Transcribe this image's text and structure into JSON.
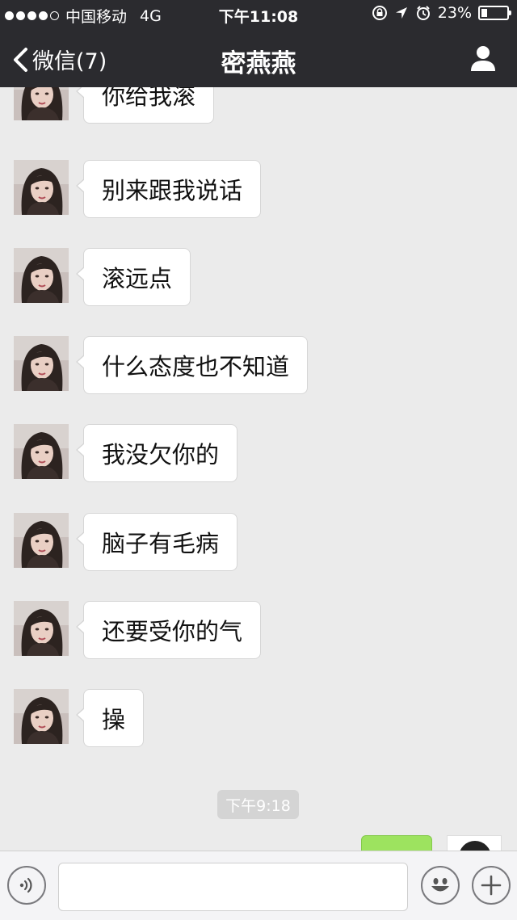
{
  "status_bar": {
    "carrier": "中国移动",
    "network": "4G",
    "time": "下午11:08",
    "battery": "23%",
    "battery_level": 0.23
  },
  "nav": {
    "back_label": "微信(7)",
    "title": "密燕燕"
  },
  "messages": [
    {
      "text": "你给我滚"
    },
    {
      "text": "别来跟我说话"
    },
    {
      "text": "滚远点"
    },
    {
      "text": "什么态度也不知道"
    },
    {
      "text": "我没欠你的"
    },
    {
      "text": "脑子有毛病"
    },
    {
      "text": "还要受你的气"
    },
    {
      "text": "操"
    }
  ],
  "timestamp": "下午9:18",
  "input": {
    "value": "",
    "placeholder": ""
  },
  "colors": {
    "nav_background": "#2b2b2f",
    "chat_background": "#ebebeb",
    "sent_bubble": "#9de35f"
  },
  "icons": {
    "back": "chevron-left-icon",
    "contact": "person-icon",
    "voice": "voice-icon",
    "emoji": "emoji-icon",
    "more": "plus-icon"
  }
}
